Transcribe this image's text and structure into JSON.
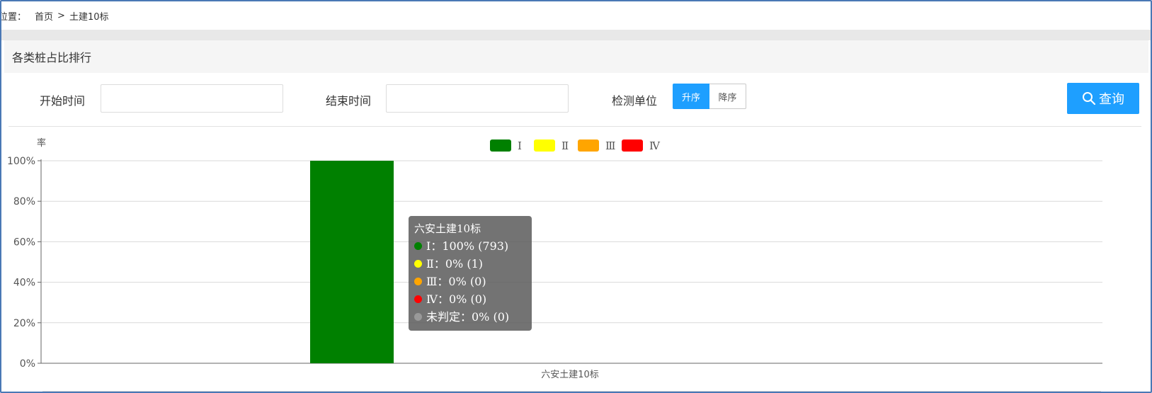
{
  "breadcrumb": {
    "prefix": "位置：",
    "home": "首页",
    "separator": ">",
    "current": "土建10标"
  },
  "panel": {
    "title": "各类桩占比排行"
  },
  "filters": {
    "start_label": "开始时间",
    "start_value": "",
    "end_label": "结束时间",
    "end_value": "",
    "unit_label": "检测单位",
    "sort_asc": "升序",
    "sort_desc": "降序",
    "query_label": "查询"
  },
  "colors": {
    "accent": "#1e9fff",
    "I": "#008000",
    "II": "#ffff00",
    "III": "#ffa500",
    "IV": "#ff0000",
    "undetermined": "#999999"
  },
  "chart_data": {
    "type": "bar",
    "ylabel": "率",
    "categories": [
      "六安土建10标"
    ],
    "series": [
      {
        "name": "Ⅰ",
        "color": "#008000",
        "values": [
          100
        ]
      },
      {
        "name": "Ⅱ",
        "color": "#ffff00",
        "values": [
          0
        ]
      },
      {
        "name": "Ⅲ",
        "color": "#ffa500",
        "values": [
          0
        ]
      },
      {
        "name": "Ⅳ",
        "color": "#ff0000",
        "values": [
          0
        ]
      }
    ],
    "ylim": [
      0,
      100
    ],
    "yticks": [
      "0%",
      "20%",
      "40%",
      "60%",
      "80%",
      "100%"
    ],
    "grid": true,
    "legend_position": "top-center"
  },
  "tooltip": {
    "title": "六安土建10标",
    "rows": [
      {
        "text": "Ⅰ：100%  (793)",
        "color": "#008000"
      },
      {
        "text": "Ⅱ：0%  (1)",
        "color": "#ffff00"
      },
      {
        "text": "Ⅲ：0%  (0)",
        "color": "#ffa500"
      },
      {
        "text": "Ⅳ：0%  (0)",
        "color": "#ff0000"
      },
      {
        "text": "未判定：0%  (0)",
        "color": "#999999"
      }
    ]
  }
}
